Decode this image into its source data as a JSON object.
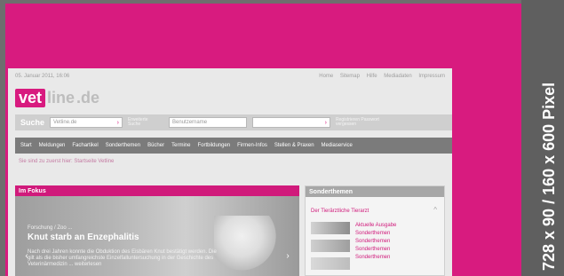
{
  "labels": {
    "top": "…",
    "vertical": "728 x 90 / 160 x 600 Pixel"
  },
  "screenshot": {
    "meta_date": "05. Januar 2011, 16:06",
    "meta_links": [
      "Home",
      "Sitemap",
      "Hilfe",
      "Mediadaten",
      "Impressum"
    ],
    "logo": {
      "mark": "vet",
      "line": "line",
      "domain": ".de"
    },
    "search": {
      "label": "Suche",
      "placeholder": "Vetline.de",
      "note": "Erweiterte Suche",
      "login_label": "Login",
      "login_placeholder": "Benutzername",
      "password_placeholder": "",
      "login_note": "Registrieren Passwort vergessen"
    },
    "nav_items": [
      "Start",
      "Meldungen",
      "Fachartikel",
      "Sonderthemen",
      "Bücher",
      "Termine",
      "Fortbildungen",
      "Firmen-Infos",
      "Stellen & Praxen",
      "Mediaservice"
    ],
    "breadcrumb": "Sie sind zu zuerst hier: Startseite Vetline",
    "focus": {
      "title": "Im Fokus",
      "kicker": "Forschung / Zoo ...",
      "headline": "Knut starb an Enzephalitis",
      "teaser": "Nach drei Jahren konnte die Obduktion des Eisbären Knut bestätigt werden. Die gilt als die bisher umfangreichste Einzelfalluntersuchung in der Geschichte des Veterinärmedizin ... weiterlesen"
    },
    "side": {
      "title": "Sonderthemen",
      "subtitle": "Der Tierärztliche Tierarzt",
      "links": [
        "Aktuelle Ausgabe",
        "Sonderthemen",
        "Sonderthemen",
        "Sonderthemen",
        "Sonderthemen"
      ]
    }
  }
}
